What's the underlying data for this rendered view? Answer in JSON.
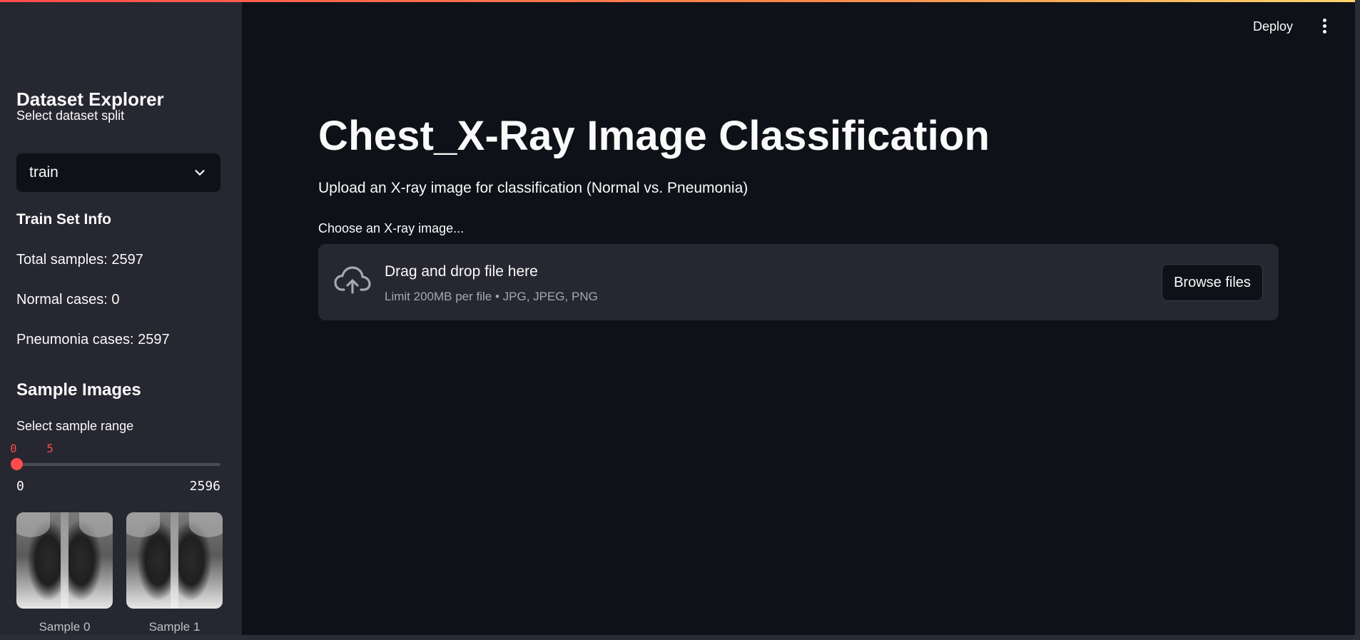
{
  "header": {
    "deploy_label": "Deploy",
    "menu_icon": "kebab-menu-icon"
  },
  "sidebar": {
    "title": "Dataset Explorer",
    "split_label": "Select dataset split",
    "split_value": "train",
    "info_title": "Train Set Info",
    "total_samples": "Total samples: 2597",
    "normal_cases": "Normal cases: 0",
    "pneumonia_cases": "Pneumonia cases: 2597",
    "samples_title": "Sample Images",
    "range_label": "Select sample range",
    "range_low": "0",
    "range_high": "5",
    "range_min": "0",
    "range_max": "2596",
    "samples": [
      {
        "caption": "Sample 0"
      },
      {
        "caption": "Sample 1"
      }
    ]
  },
  "main": {
    "title": "Chest_X-Ray Image Classification",
    "subtitle": "Upload an X-ray image for classification (Normal vs. Pneumonia)",
    "uploader_label": "Choose an X-ray image...",
    "dropzone_text": "Drag and drop file here",
    "dropzone_limit": "Limit 200MB per file • JPG, JPEG, PNG",
    "browse_label": "Browse files"
  },
  "colors": {
    "accent": "#ff4b4b",
    "background": "#0e1117",
    "sidebar": "#262730"
  }
}
